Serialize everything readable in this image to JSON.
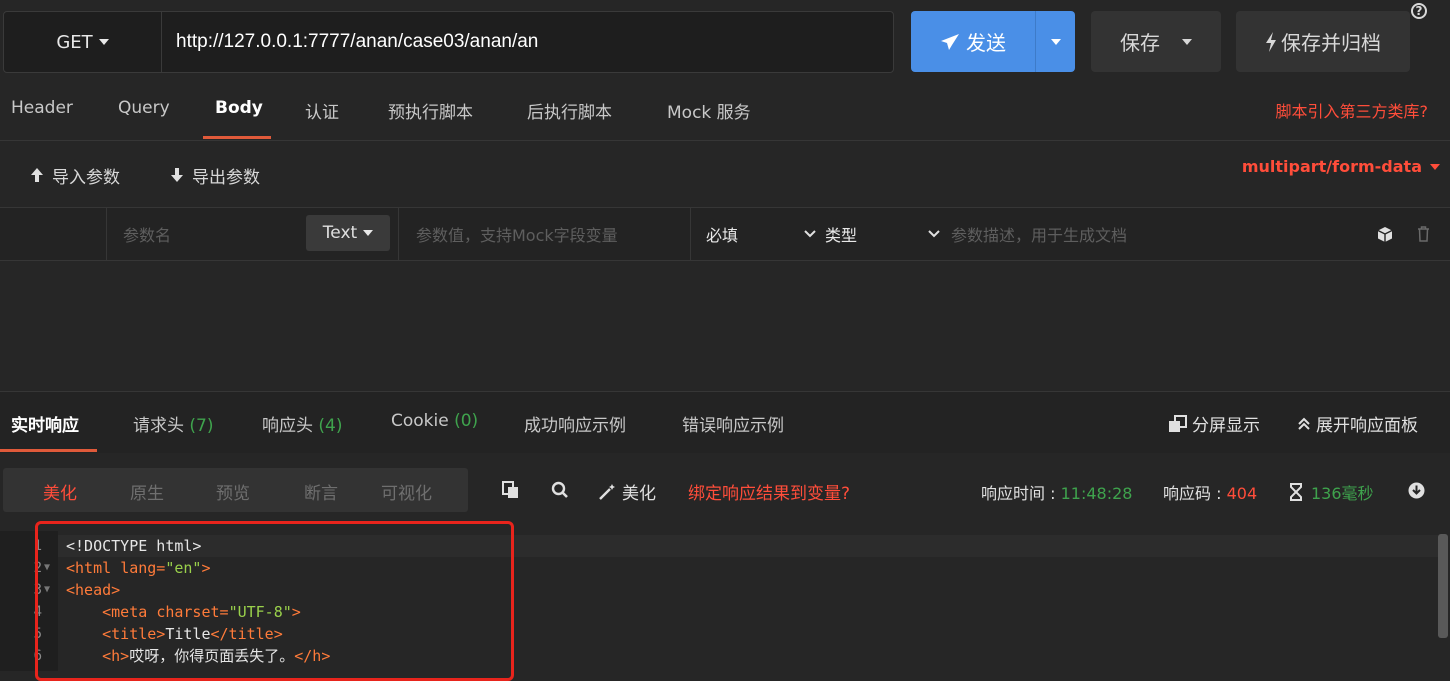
{
  "request": {
    "method": "GET",
    "url": "http://127.0.0.1:7777/anan/case03/anan/an",
    "send_label": "发送",
    "save_label": "保存",
    "save_archive_label": "保存并归档",
    "help_label": "?"
  },
  "request_tabs": [
    "Header",
    "Query",
    "Body",
    "认证",
    "预执行脚本",
    "后执行脚本",
    "Mock 服务"
  ],
  "active_request_tab": "Body",
  "third_party_link": "脚本引入第三方类库?",
  "body_toolbar": {
    "import_label": "导入参数",
    "export_label": "导出参数",
    "content_type": "multipart/form-data"
  },
  "param_row": {
    "name_placeholder": "参数名",
    "type_value": "Text",
    "value_placeholder": "参数值，支持Mock字段变量",
    "required_label": "必填",
    "type_label": "类型",
    "desc_placeholder": "参数描述，用于生成文档"
  },
  "response_tabs": {
    "realtime": "实时响应",
    "req_headers": "请求头",
    "req_headers_count": "(7)",
    "resp_headers": "响应头",
    "resp_headers_count": "(4)",
    "cookie": "Cookie",
    "cookie_count": "(0)",
    "success_example": "成功响应示例",
    "error_example": "错误响应示例",
    "split_view": "分屏显示",
    "expand_panel": "展开响应面板"
  },
  "view_modes": [
    "美化",
    "原生",
    "预览",
    "断言",
    "可视化"
  ],
  "active_view_mode": "美化",
  "response_toolbar": {
    "beautify_label": "美化",
    "bind_label": "绑定响应结果到变量?",
    "time_label": "响应时间 : ",
    "time_value": "11:48:28",
    "code_label": "响应码 : ",
    "code_value": "404",
    "duration_value": "136毫秒"
  },
  "code_lines": [
    {
      "num": "1",
      "t1": "<!DOCTYPE html>",
      "fold": false
    },
    {
      "num": "2",
      "fold": true,
      "tag_open": "<html ",
      "attr": "lang=",
      "str": "\"en\"",
      "tag_close": ">"
    },
    {
      "num": "3",
      "fold": true,
      "tag_open": "<head>"
    },
    {
      "num": "4",
      "fold": false,
      "indent": "    ",
      "tag_open": "<meta ",
      "attr": "charset=",
      "str": "\"UTF-8\"",
      "tag_close": ">"
    },
    {
      "num": "5",
      "fold": false,
      "indent": "    ",
      "tag_open": "<title>",
      "text": "Title",
      "tag_close": "</title>"
    },
    {
      "num": "6",
      "fold": false,
      "indent": "    ",
      "tag_open": "<h>",
      "text": "哎呀，你得页面丢失了。",
      "tag_close": "</h>"
    }
  ],
  "colors": {
    "accent_blue": "#4a8fe7",
    "accent_red": "#ff4d3a",
    "success_green": "#3fa34d",
    "highlight_box": "#e8241c"
  }
}
